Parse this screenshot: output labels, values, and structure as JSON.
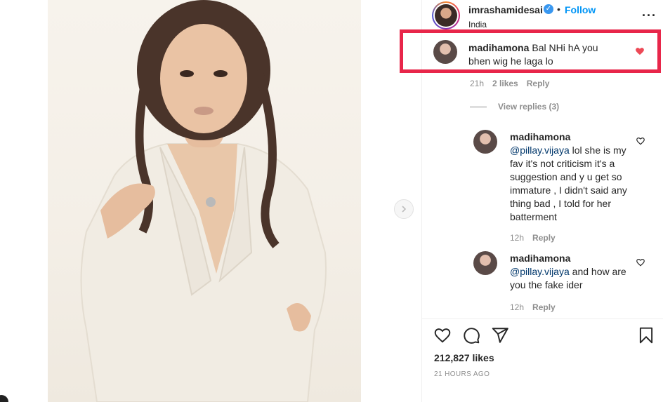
{
  "post": {
    "username": "imrashamidesai",
    "follow_label": "Follow",
    "separator": "•",
    "location": "India",
    "more_icon": "···"
  },
  "highlighted_comment": {
    "username": "madihamona",
    "text": "Bal NHi hA you bhen wig he laga lo",
    "time": "21h",
    "likes": "2 likes",
    "reply_label": "Reply"
  },
  "view_replies": "View replies (3)",
  "replies": [
    {
      "username": "madihamona",
      "mention": "@pillay.vijaya",
      "text": "lol she is my fav it's not criticism it's a suggestion and y u get so immature , I didn't said any thing bad , I told for her batterment",
      "time": "12h",
      "reply_label": "Reply"
    },
    {
      "username": "madihamona",
      "mention": "@pillay.vijaya",
      "text": "and how are you the fake ider",
      "time": "12h",
      "reply_label": "Reply"
    }
  ],
  "stats": {
    "likes": "212,827 likes",
    "time_ago": "21 HOURS AGO"
  },
  "colors": {
    "accent_blue": "#0095f6",
    "highlight_red": "#e8264a",
    "liked_heart": "#ed4956",
    "muted_text": "#8e8e8e"
  },
  "icons": {
    "verified": "verified-badge-icon",
    "heart": "heart-icon",
    "comment": "comment-icon",
    "share": "share-icon",
    "save": "bookmark-icon",
    "next": "chevron-right-icon"
  }
}
